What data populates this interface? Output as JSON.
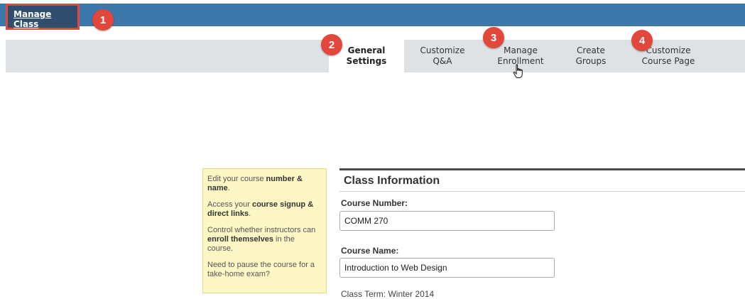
{
  "header": {
    "manage_class": "Manage Class"
  },
  "tabs": [
    {
      "label": "General\nSettings",
      "active": true
    },
    {
      "label": "Customize\nQ&A",
      "active": false
    },
    {
      "label": "Manage\nEnrollment",
      "active": false
    },
    {
      "label": "Create\nGroups",
      "active": false
    },
    {
      "label": "Customize\nCourse Page",
      "active": false
    }
  ],
  "callouts": [
    "1",
    "2",
    "3",
    "4"
  ],
  "sidebar_help": {
    "p1": {
      "t1": "Edit your course ",
      "b1": "number &",
      "t2": " ",
      "b2": "name",
      "t3": "."
    },
    "p2": {
      "t1": "Access your ",
      "b1": "course signup & direct links",
      "t2": "."
    },
    "p3": {
      "t1": "Control whether instructors can ",
      "b1": "enroll themselves",
      "t2": " in the course."
    },
    "p4": {
      "t1": "Need to pause the course for a take-home exam?"
    }
  },
  "class_info": {
    "title": "Class Information",
    "course_number_label": "Course Number:",
    "course_number_value": "COMM 270",
    "course_name_label": "Course Name:",
    "course_name_value": "Introduction to Web Design",
    "class_term_partial": "Class Term:   Winter 2014"
  },
  "colors": {
    "topbar": "#3e78ab",
    "callout": "#e2473b",
    "help_bg": "#fdf6c5"
  },
  "icons": {
    "cursor": "hand-pointer-icon"
  }
}
